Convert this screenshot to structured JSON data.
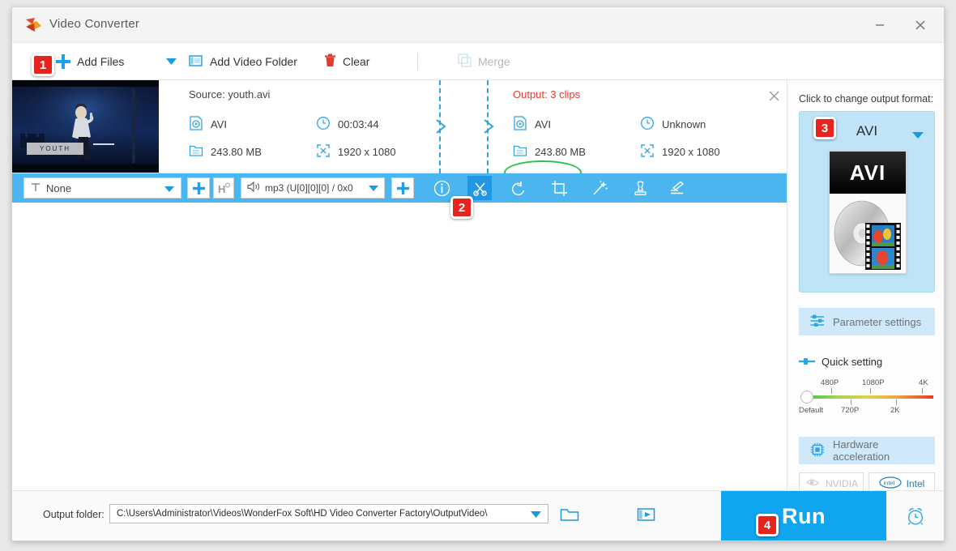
{
  "window": {
    "title": "Video Converter",
    "minimize_label": "Minimize",
    "close_label": "Close"
  },
  "toolbar": {
    "add_files": "Add Files",
    "add_files_caret": "add-files-dropdown",
    "add_video_folder": "Add Video Folder",
    "clear": "Clear",
    "merge": "Merge"
  },
  "file_card": {
    "thumbnail_caption": "YOUTH",
    "source": {
      "title": "Source: youth.avi",
      "format": "AVI",
      "duration": "00:03:44",
      "size": "243.80 MB",
      "resolution": "1920 x 1080"
    },
    "output": {
      "title": "Output: 3 clips",
      "title_color": "#e8392e",
      "annotation_color": "#2fc14f",
      "format": "AVI",
      "duration": "Unknown",
      "size": "243.80 MB",
      "resolution": "1920 x 1080"
    },
    "remove_label": "Remove"
  },
  "blue_bar": {
    "subtitle_value": "None",
    "subtitle_add_label": "+",
    "hardsub_label": "H",
    "audio_value": "mp3 (U[0][0][0] / 0x0",
    "audio_add_label": "+",
    "background": "#4bb5f0",
    "tools": [
      {
        "name": "info-icon",
        "label": "Information",
        "active": false
      },
      {
        "name": "cut-icon",
        "label": "Cut",
        "active": true
      },
      {
        "name": "rotate-icon",
        "label": "Rotate",
        "active": false
      },
      {
        "name": "crop-icon",
        "label": "Crop",
        "active": false
      },
      {
        "name": "effects-icon",
        "label": "Effects",
        "active": false
      },
      {
        "name": "watermark-icon",
        "label": "Watermark",
        "active": false
      },
      {
        "name": "subtitle-icon",
        "label": "Subtitle",
        "active": false
      }
    ]
  },
  "right_panel": {
    "change_format_label": "Click to change output format:",
    "format_name": "AVI",
    "format_icon_text": "AVI",
    "parameter_settings": "Parameter settings",
    "quick_setting": "Quick setting",
    "slider": {
      "value": "Default",
      "top_labels": [
        "480P",
        "1080P",
        "4K"
      ],
      "bottom_labels": [
        "Default",
        "720P",
        "2K"
      ],
      "gradient_start": "#45c455",
      "gradient_end": "#ea3b25"
    },
    "hardware_acceleration": "Hardware acceleration",
    "gpu_options": [
      {
        "label": "NVIDIA",
        "enabled": false
      },
      {
        "label": "Intel",
        "enabled": true
      }
    ]
  },
  "bottom_bar": {
    "output_folder_label": "Output folder:",
    "output_folder_path": "C:\\Users\\Administrator\\Videos\\WonderFox Soft\\HD Video Converter Factory\\OutputVideo\\",
    "open_folder_label": "Open folder",
    "media_label": "Media",
    "run_label": "Run",
    "run_color": "#10a6ef",
    "schedule_label": "Schedule"
  },
  "annotations": {
    "badges": [
      "1",
      "2",
      "3",
      "4"
    ],
    "badge_color": "#e8231e"
  }
}
